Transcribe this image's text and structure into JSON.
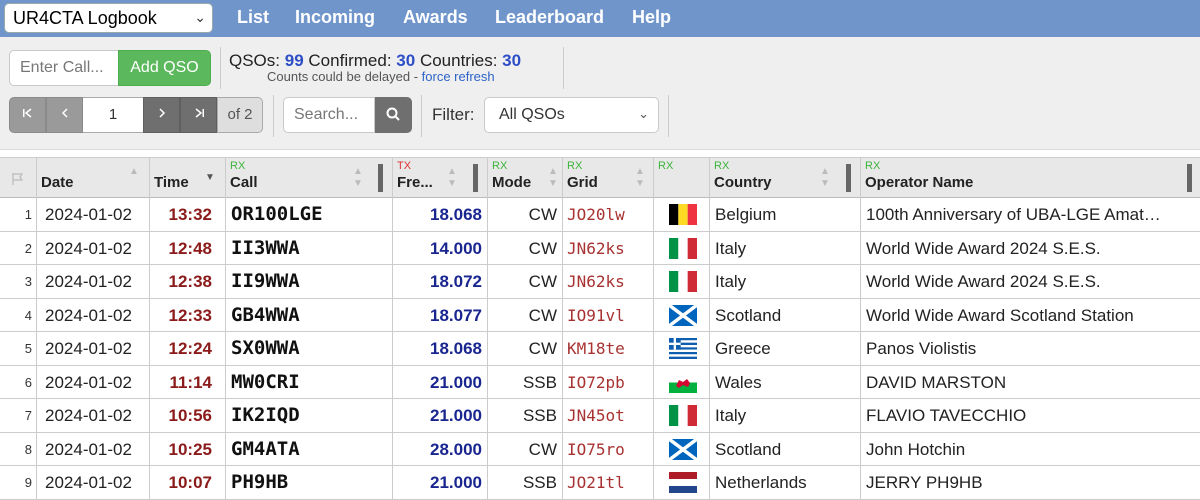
{
  "app": {
    "logbook_selected": "UR4CTA Logbook",
    "nav": [
      "List",
      "Incoming",
      "Awards",
      "Leaderboard",
      "Help"
    ]
  },
  "toolbar": {
    "call_placeholder": "Enter Call...",
    "add_qso_label": "Add QSO",
    "qsos_label": "QSOs:",
    "qsos_value": "99",
    "confirmed_label": "Confirmed:",
    "confirmed_value": "30",
    "countries_label": "Countries:",
    "countries_value": "30",
    "note_text": "Counts could be delayed - ",
    "force_refresh": "force refresh",
    "page_current": "1",
    "page_total": "of 2",
    "search_placeholder": "Search...",
    "filter_label": "Filter:",
    "filter_value": "All QSOs"
  },
  "table": {
    "headers": {
      "date": "Date",
      "time": "Time",
      "call": "Call",
      "freq": "Fre...",
      "mode": "Mode",
      "grid": "Grid",
      "country": "Country",
      "operator": "Operator Name",
      "rx": "RX",
      "tx": "TX"
    },
    "rows": [
      {
        "idx": "1",
        "date": "2024-01-02",
        "time": "13:32",
        "call": "OR100LGE",
        "freq": "18.068",
        "mode": "CW",
        "grid": "JO20lw",
        "flag": "belgium",
        "country": "Belgium",
        "operator": "100th Anniversary of UBA-LGE Amat…"
      },
      {
        "idx": "2",
        "date": "2024-01-02",
        "time": "12:48",
        "call": "II3WWA",
        "freq": "14.000",
        "mode": "CW",
        "grid": "JN62ks",
        "flag": "italy",
        "country": "Italy",
        "operator": "World Wide Award 2024 S.E.S."
      },
      {
        "idx": "3",
        "date": "2024-01-02",
        "time": "12:38",
        "call": "II9WWA",
        "freq": "18.072",
        "mode": "CW",
        "grid": "JN62ks",
        "flag": "italy",
        "country": "Italy",
        "operator": "World Wide Award 2024 S.E.S."
      },
      {
        "idx": "4",
        "date": "2024-01-02",
        "time": "12:33",
        "call": "GB4WWA",
        "freq": "18.077",
        "mode": "CW",
        "grid": "IO91vl",
        "flag": "scotland",
        "country": "Scotland",
        "operator": "World Wide Award Scotland Station"
      },
      {
        "idx": "5",
        "date": "2024-01-02",
        "time": "12:24",
        "call": "SX0WWA",
        "freq": "18.068",
        "mode": "CW",
        "grid": "KM18te",
        "flag": "greece",
        "country": "Greece",
        "operator": "Panos Violistis"
      },
      {
        "idx": "6",
        "date": "2024-01-02",
        "time": "11:14",
        "call": "MW0CRI",
        "freq": "21.000",
        "mode": "SSB",
        "grid": "IO72pb",
        "flag": "wales",
        "country": "Wales",
        "operator": "DAVID MARSTON"
      },
      {
        "idx": "7",
        "date": "2024-01-02",
        "time": "10:56",
        "call": "IK2IQD",
        "freq": "21.000",
        "mode": "SSB",
        "grid": "JN45ot",
        "flag": "italy",
        "country": "Italy",
        "operator": "FLAVIO TAVECCHIO"
      },
      {
        "idx": "8",
        "date": "2024-01-02",
        "time": "10:25",
        "call": "GM4ATA",
        "freq": "28.000",
        "mode": "CW",
        "grid": "IO75ro",
        "flag": "scotland",
        "country": "Scotland",
        "operator": "John Hotchin"
      },
      {
        "idx": "9",
        "date": "2024-01-02",
        "time": "10:07",
        "call": "PH9HB",
        "freq": "21.000",
        "mode": "SSB",
        "grid": "JO21tl",
        "flag": "netherlands",
        "country": "Netherlands",
        "operator": "JERRY PH9HB"
      }
    ]
  }
}
